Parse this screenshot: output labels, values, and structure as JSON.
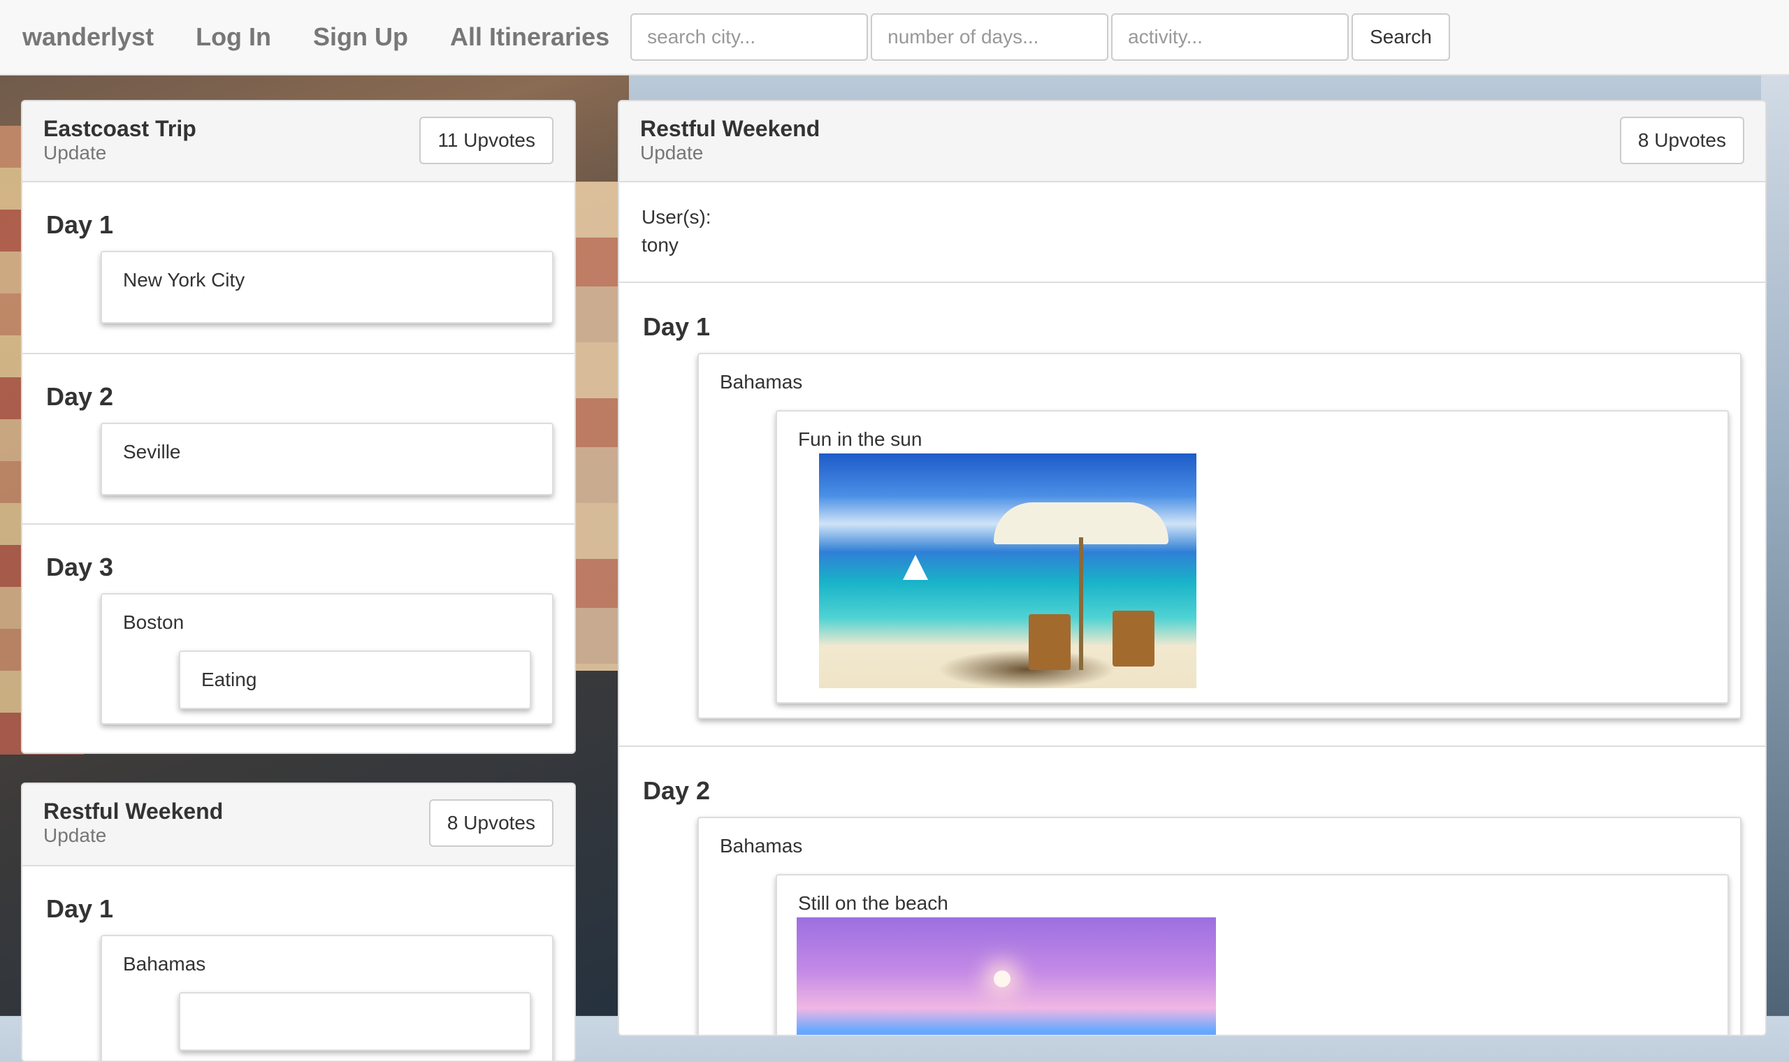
{
  "nav": {
    "brand": "wanderlyst",
    "links": [
      "Log In",
      "Sign Up",
      "All Itineraries"
    ],
    "search_city_placeholder": "search city...",
    "days_placeholder": "number of days...",
    "activity_placeholder": "activity...",
    "search_label": "Search"
  },
  "left_itineraries": [
    {
      "title": "Eastcoast Trip",
      "update_label": "Update",
      "upvotes": "11 Upvotes",
      "days": [
        {
          "label": "Day 1",
          "city": "New York City"
        },
        {
          "label": "Day 2",
          "city": "Seville"
        },
        {
          "label": "Day 3",
          "city": "Boston",
          "activity": "Eating"
        }
      ]
    },
    {
      "title": "Restful Weekend",
      "update_label": "Update",
      "upvotes": "8 Upvotes",
      "days": [
        {
          "label": "Day 1",
          "city": "Bahamas"
        }
      ]
    }
  ],
  "detail": {
    "title": "Restful Weekend",
    "update_label": "Update",
    "upvotes": "8 Upvotes",
    "users_label": "User(s):",
    "users": "tony",
    "days": [
      {
        "label": "Day 1",
        "city": "Bahamas",
        "activity": "Fun in the sun",
        "image": "beach-chairs-umbrella-photo"
      },
      {
        "label": "Day 2",
        "city": "Bahamas",
        "activity": "Still on the beach",
        "image": "sunset-beach-photo"
      }
    ]
  }
}
